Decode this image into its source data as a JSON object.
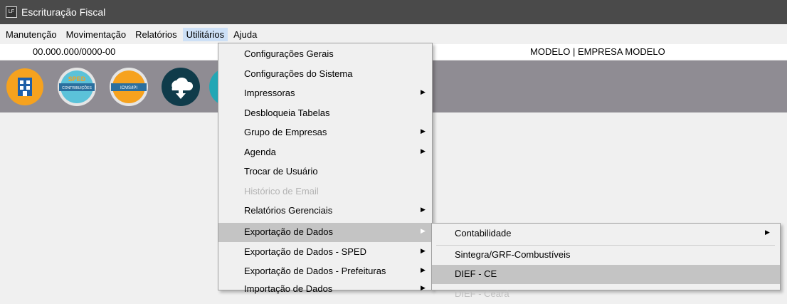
{
  "window": {
    "title": "Escrituração Fiscal",
    "icon_text": "LF"
  },
  "menubar": {
    "items": [
      {
        "label": "Manutenção"
      },
      {
        "label": "Movimentação"
      },
      {
        "label": "Relatórios"
      },
      {
        "label": "Utilitários"
      },
      {
        "label": "Ajuda"
      }
    ]
  },
  "infobar": {
    "cnpj": "00.000.000/0000-00",
    "empresa": "MODELO | EMPRESA MODELO"
  },
  "toolbar": {
    "icons": [
      {
        "name": "building-icon",
        "color": "#f6a21e"
      },
      {
        "name": "sped-contribuicoes-icon",
        "label": "SPED",
        "sublabel": "CONTRIBUIÇÕES",
        "color": "#5bc2d9"
      },
      {
        "name": "icms-ipi-icon",
        "label": "ICMS/IPI",
        "color": "#f6a21e"
      },
      {
        "name": "cloud-download-icon",
        "color": "#0f3b4a"
      },
      {
        "name": "partial-icon",
        "color": "#22a7b5"
      }
    ]
  },
  "utilitarios_menu": {
    "items": [
      {
        "label": "Configurações Gerais",
        "submenu": false
      },
      {
        "label": "Configurações do Sistema",
        "submenu": false
      },
      {
        "label": "Impressoras",
        "submenu": true
      },
      {
        "label": "Desbloqueia Tabelas",
        "submenu": false
      },
      {
        "label": "Grupo de Empresas",
        "submenu": true
      },
      {
        "label": "Agenda",
        "submenu": true
      },
      {
        "label": "Trocar de Usuário",
        "submenu": false
      },
      {
        "label": "Histórico de Email",
        "submenu": false,
        "disabled": true
      },
      {
        "label": "Relatórios Gerenciais",
        "submenu": true
      },
      {
        "label": "Exportação de Dados",
        "submenu": true,
        "highlighted": true
      },
      {
        "label": "Exportação de Dados - SPED",
        "submenu": true
      },
      {
        "label": "Exportação de Dados - Prefeituras",
        "submenu": true
      },
      {
        "label": "Importação de Dados",
        "submenu": true
      }
    ]
  },
  "exportacao_submenu": {
    "items": [
      {
        "label": "Contabilidade",
        "submenu": true
      },
      {
        "label": "Sintegra/GRF-Combustíveis",
        "submenu": false
      },
      {
        "label": "DIEF - CE",
        "submenu": false,
        "highlighted": true
      },
      {
        "label": "DIEF - Ceará",
        "submenu": false,
        "disabled": true
      }
    ]
  }
}
